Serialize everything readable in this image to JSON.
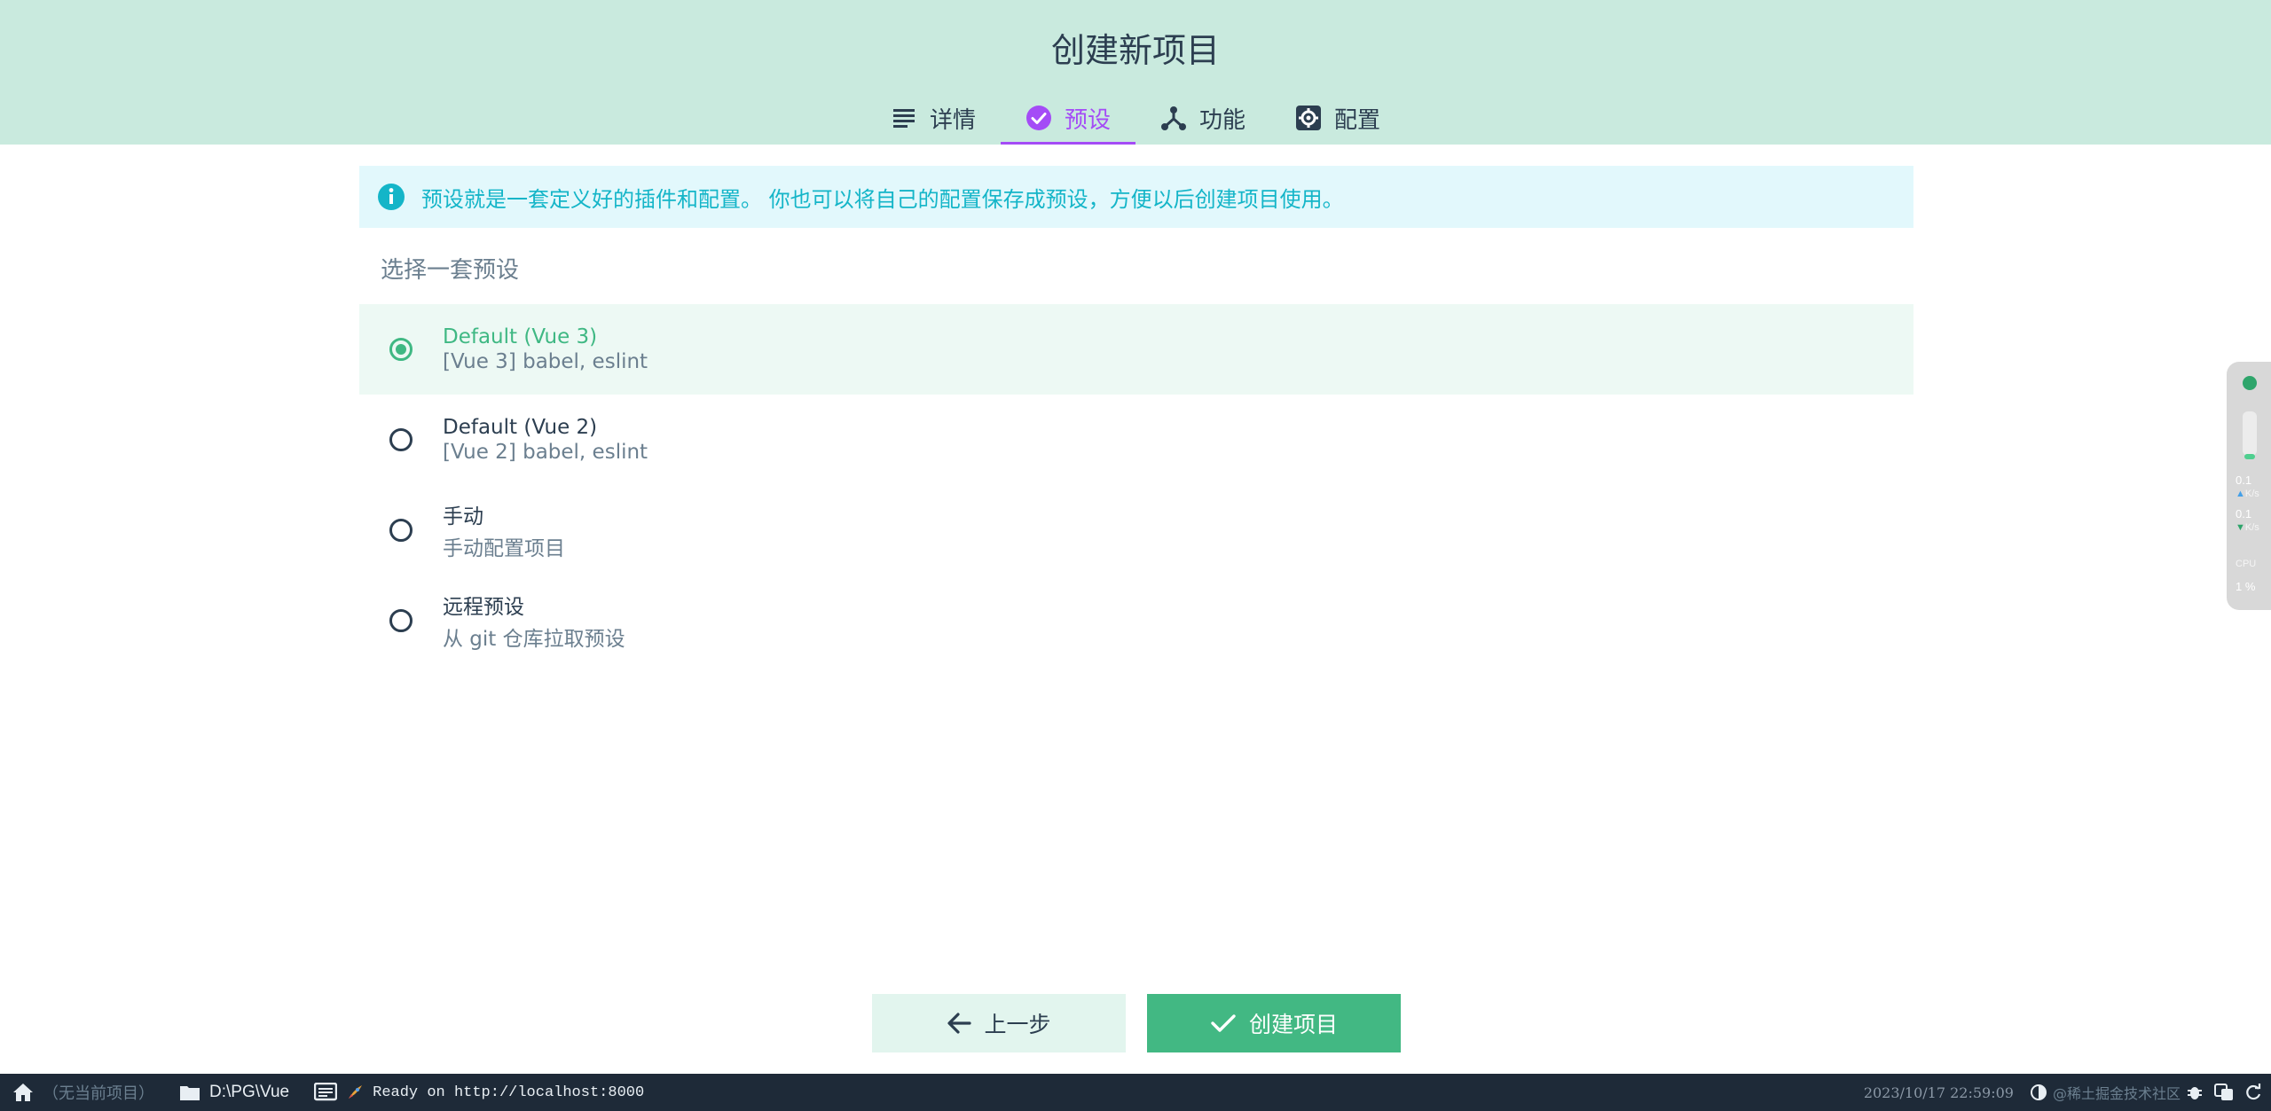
{
  "header": {
    "title": "创建新项目",
    "tabs": [
      {
        "label": "详情",
        "icon": "list-icon",
        "active": false
      },
      {
        "label": "预设",
        "icon": "check-circle-icon",
        "active": true
      },
      {
        "label": "功能",
        "icon": "fork-icon",
        "active": false
      },
      {
        "label": "配置",
        "icon": "gear-icon",
        "active": false
      }
    ]
  },
  "info": {
    "text": "预设就是一套定义好的插件和配置。 你也可以将自己的配置保存成预设，方便以后创建项目使用。",
    "icon": "info-icon"
  },
  "presets_title": "选择一套预设",
  "presets": [
    {
      "name": "Default (Vue 3)",
      "desc": "[Vue 3] babel, eslint",
      "selected": true
    },
    {
      "name": "Default (Vue 2)",
      "desc": "[Vue 2] babel, eslint",
      "selected": false
    },
    {
      "name": "手动",
      "desc": "手动配置项目",
      "selected": false
    },
    {
      "name": "远程预设",
      "desc": "从 git 仓库拉取预设",
      "selected": false
    }
  ],
  "actions": {
    "prev_label": "上一步",
    "create_label": "创建项目"
  },
  "widget": {
    "up_value": "0.1",
    "up_unit": "K/s",
    "down_value": "0.1",
    "down_unit": "K/s",
    "cpu_label": "CPU",
    "cpu_value": "1 %"
  },
  "statusbar": {
    "project": "（无当前项目）",
    "path": "D:\\PG\\Vue",
    "log": "Ready on http://localhost:8000",
    "datetime": "2023/10/17 22:59:09",
    "watermark": "@稀土掘金技术社区"
  },
  "colors": {
    "header_bg": "#c9eade",
    "accent_purple": "#a44cf6",
    "accent_green": "#42b883",
    "info_text": "#14b5c8",
    "info_bg": "#e2f8fc",
    "statusbar_bg": "#1e2a38"
  }
}
